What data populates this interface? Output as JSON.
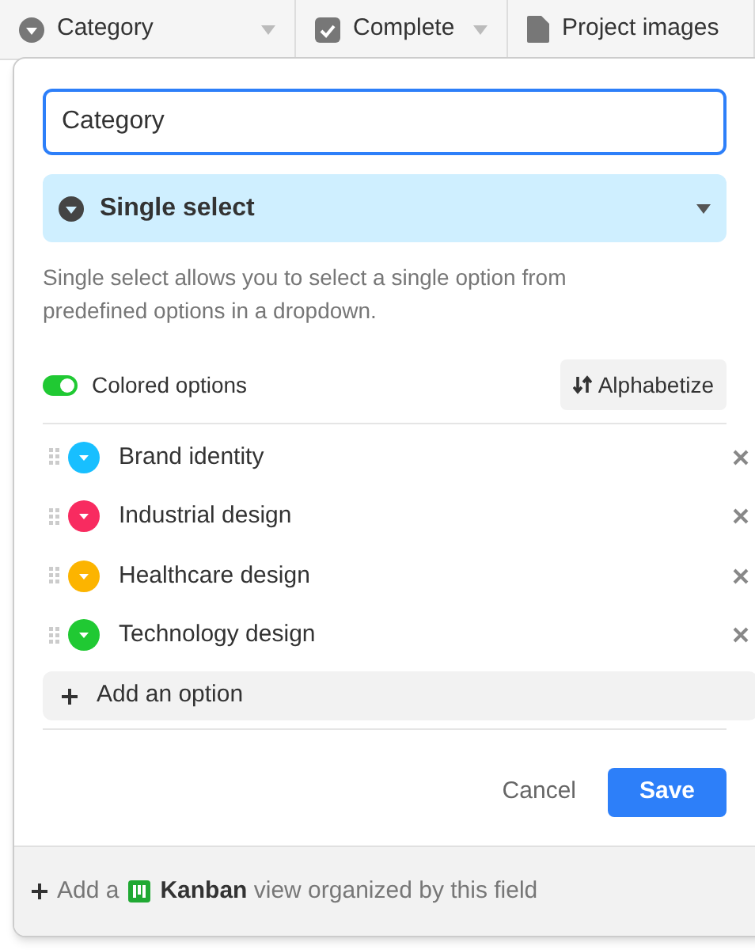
{
  "columns": [
    {
      "kind": "select",
      "label": "Category",
      "menu": true
    },
    {
      "kind": "checkbox",
      "label": "Complete",
      "menu": true
    },
    {
      "kind": "attachment",
      "label": "Project images",
      "menu": false
    }
  ],
  "field_name": {
    "value": "Category"
  },
  "field_type": {
    "label": "Single select"
  },
  "description": "Single select allows you to select a single option from predefined options in a dropdown.",
  "colored_options": {
    "label": "Colored options",
    "on": true
  },
  "alphabetize": {
    "label": "Alphabetize"
  },
  "options": [
    {
      "label": "Brand identity",
      "color": "#18bfff"
    },
    {
      "label": "Industrial design",
      "color": "#f82b60"
    },
    {
      "label": "Healthcare design",
      "color": "#fcb400"
    },
    {
      "label": "Technology design",
      "color": "#20c933"
    }
  ],
  "add_option": {
    "label": "Add an option"
  },
  "buttons": {
    "cancel": "Cancel",
    "save": "Save"
  },
  "footer": {
    "prefix": "Add a",
    "text": "**Kanban** view organized by this field"
  }
}
